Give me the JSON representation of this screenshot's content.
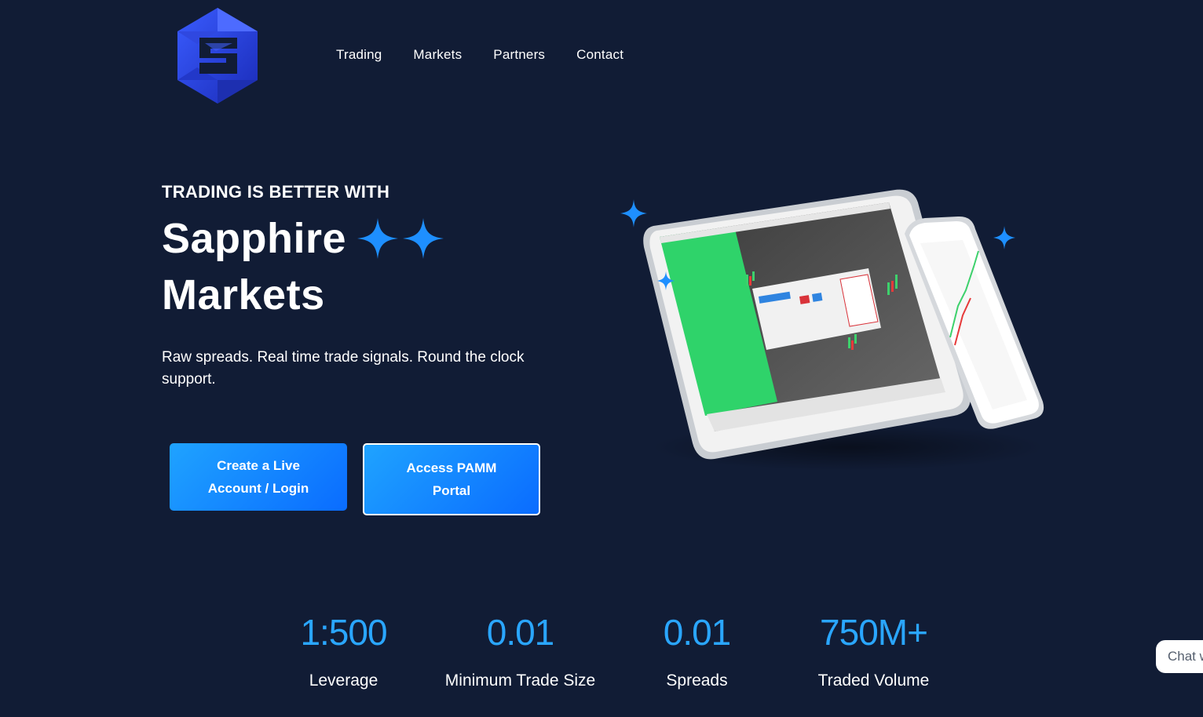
{
  "brand": {
    "logo_icon": "sapphire-hexagon-logo"
  },
  "nav": {
    "items": [
      {
        "label": "Trading"
      },
      {
        "label": "Markets"
      },
      {
        "label": "Partners"
      },
      {
        "label": "Contact"
      }
    ]
  },
  "hero": {
    "eyebrow": "TRADING IS BETTER WITH",
    "headline_line1": "Sapphire",
    "headline_line2": "Markets",
    "sparkle_icon": "sparkle-icon",
    "tagline": "Raw spreads. Real time trade signals. Round the clock support.",
    "buttons": {
      "live_account": "Create a Live Account / Login",
      "pamm": "Access PAMM Portal"
    }
  },
  "stats": [
    {
      "value": "1:500",
      "label": "Leverage"
    },
    {
      "value": "0.01",
      "label": "Minimum Trade Size"
    },
    {
      "value": "0.01",
      "label": "Spreads"
    },
    {
      "value": "750M+",
      "label": "Traded Volume"
    }
  ],
  "chat": {
    "label": "Chat w"
  },
  "colors": {
    "background": "#111c35",
    "accent": "#2aa6ff",
    "button": "#0a6cff"
  }
}
